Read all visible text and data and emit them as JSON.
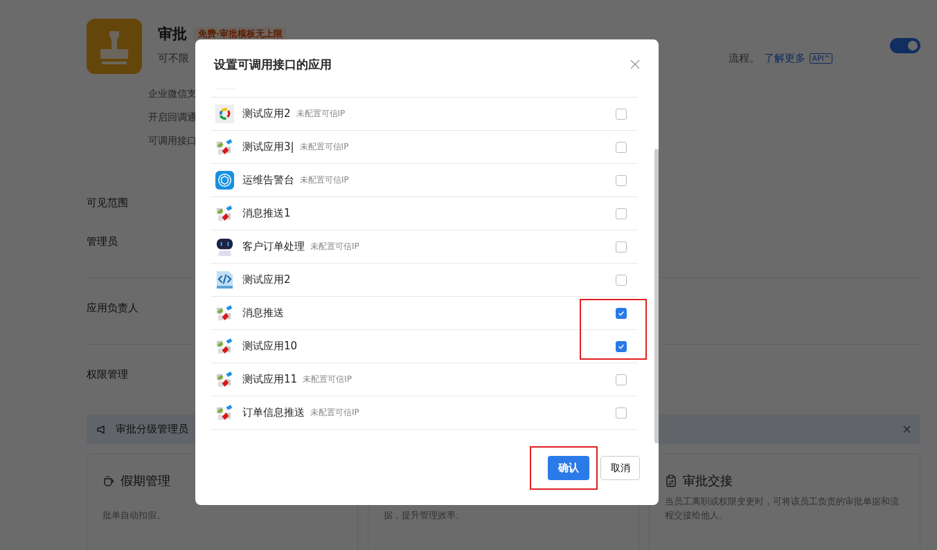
{
  "app": {
    "name": "审批",
    "tag": "免费·审批模板无上限",
    "description": "可不限",
    "description_end": "流程。",
    "learn_more": "了解更多",
    "api_badge": "API^",
    "enabled": true
  },
  "info_rows": [
    "企业微信支",
    "开启回调通",
    "可调用接口"
  ],
  "section_groups": [
    [
      "可见范围",
      "管理员"
    ],
    [
      "应用负责人"
    ],
    [
      "权限管理"
    ]
  ],
  "notice": {
    "text": "审批分级管理员"
  },
  "cards": [
    {
      "kind": "cup",
      "title": "假期管理",
      "text": "批单自动扣假。",
      "continued": true
    },
    {
      "text": "据，提升管理效率。",
      "continued": true
    },
    {
      "kind": "clipboard",
      "title": "审批交接",
      "text": "当员工离职或权限变更时，可将该员工负责的审批单据和流程交接给他人。"
    }
  ],
  "dialog": {
    "title": "设置可调用接口的应用",
    "items": [
      {
        "kind": "ring",
        "name": "测试应用2",
        "tag": "未配置可信IP",
        "checked": false,
        "highlighted": false
      },
      {
        "kind": "blocks",
        "name": "测试应用3|",
        "tag": "未配置可信IP",
        "checked": false,
        "highlighted": false
      },
      {
        "kind": "cube",
        "name": "运维告警台",
        "tag": "未配置可信IP",
        "checked": false,
        "highlighted": false
      },
      {
        "kind": "blocks",
        "name": "消息推送1",
        "checked": false,
        "highlighted": false
      },
      {
        "kind": "robot",
        "name": "客户订单处理",
        "tag": "未配置可信IP",
        "checked": false,
        "highlighted": false
      },
      {
        "kind": "code",
        "name": "测试应用2",
        "checked": false,
        "highlighted": false
      },
      {
        "kind": "blocks",
        "name": "消息推送",
        "checked": true,
        "highlighted": true
      },
      {
        "kind": "blocks",
        "name": "测试应用10",
        "checked": true,
        "highlighted": true
      },
      {
        "kind": "blocks",
        "name": "测试应用11",
        "tag": "未配置可信IP",
        "checked": false,
        "highlighted": false
      },
      {
        "kind": "blocks",
        "name": "订单信息推送",
        "tag": "未配置可信IP",
        "checked": false,
        "highlighted": false
      }
    ],
    "confirm": {
      "label": "确认",
      "highlighted": true
    },
    "cancel": {
      "label": "取消"
    }
  }
}
